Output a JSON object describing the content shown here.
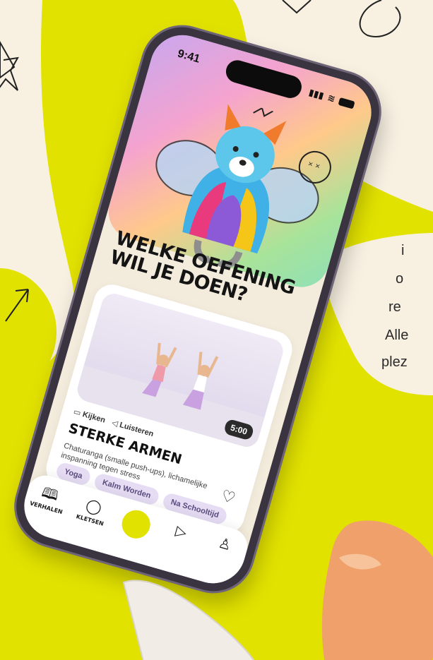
{
  "status_bar": {
    "time": "9:41"
  },
  "hero": {
    "heading": "WELKE OEFENING WIL JE DOEN?"
  },
  "exercise_card": {
    "duration": "5:00",
    "mode_watch": "Kijken",
    "mode_listen": "Luisteren",
    "title": "STERKE ARMEN",
    "description": "Chaturanga (smalle push-ups), lichamelijke inspanning tegen stress",
    "tags": [
      "Yoga",
      "Kalm Worden",
      "Na Schooltijd"
    ]
  },
  "tabbar": {
    "items": [
      {
        "label": "VERHALEN",
        "icon": "book-icon"
      },
      {
        "label": "KLETSEN",
        "icon": "chat-bubble-icon"
      },
      {
        "label": "",
        "icon": "center-action"
      },
      {
        "label": "",
        "icon": "play-icon"
      },
      {
        "label": "",
        "icon": "person-icon"
      }
    ]
  },
  "side_text": {
    "lines": [
      "i",
      "o",
      "re",
      "Alle",
      "plez"
    ]
  },
  "colors": {
    "background": "#f8f1e2",
    "accent_yellow": "#e2e200",
    "tag_bg": "#e6ddf4",
    "tag_text": "#5b4b7e"
  }
}
